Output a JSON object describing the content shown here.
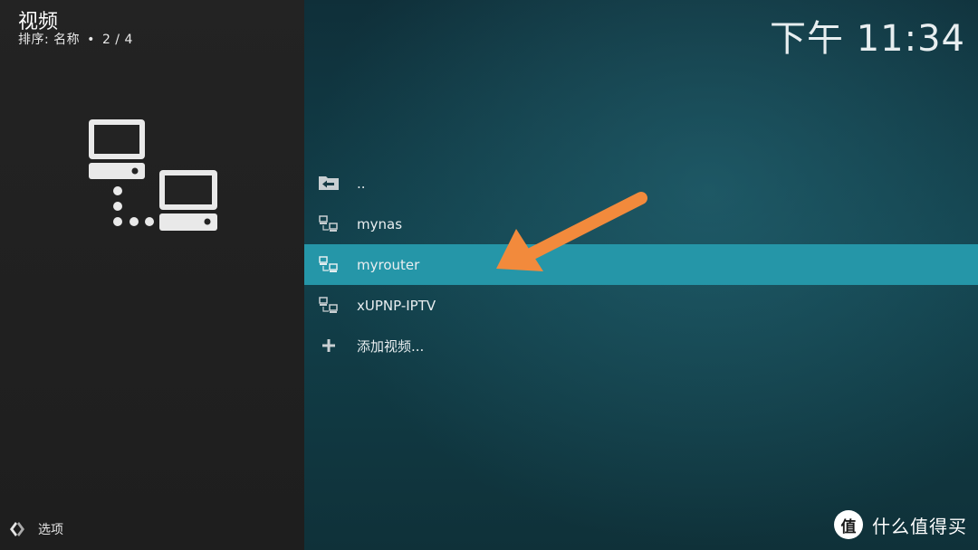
{
  "header": {
    "title": "视频",
    "sort_label": "排序: 名称",
    "separator": "•",
    "page_count": "2 / 4"
  },
  "clock": "下午 11:34",
  "list": {
    "items": [
      {
        "label": "..",
        "icon": "folder-back-icon",
        "selected": false
      },
      {
        "label": "mynas",
        "icon": "network-icon",
        "selected": false
      },
      {
        "label": "myrouter",
        "icon": "network-icon",
        "selected": true
      },
      {
        "label": "xUPNP-IPTV",
        "icon": "network-icon",
        "selected": false
      },
      {
        "label": "添加视频...",
        "icon": "plus-icon",
        "selected": false
      }
    ]
  },
  "footer": {
    "options_label": "选项",
    "options_icon": "options-icon"
  },
  "watermark": {
    "text": "什么值得买",
    "logo_char": "值"
  },
  "colors": {
    "selection": "#2596a8",
    "annotation_arrow": "#f28a3c",
    "left_panel": "#1f1f1f"
  }
}
